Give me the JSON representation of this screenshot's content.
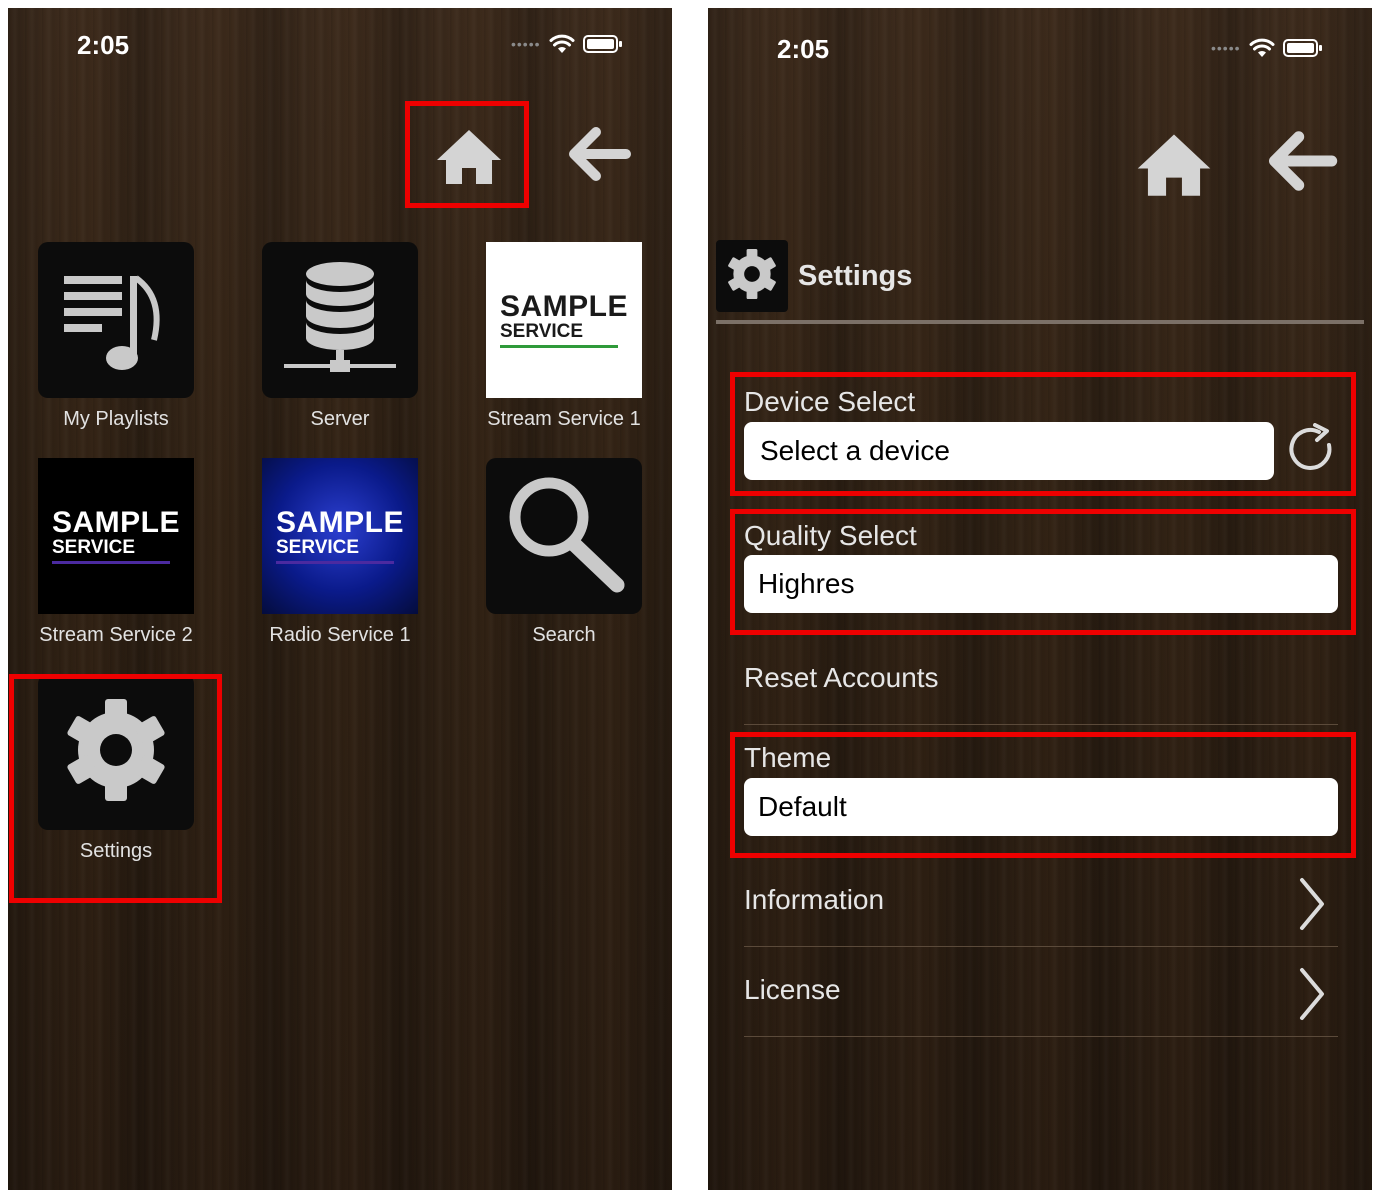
{
  "left": {
    "status": {
      "time": "2:05"
    },
    "grid": [
      {
        "label": "My Playlists",
        "icon": "playlist-music-icon"
      },
      {
        "label": "Server",
        "icon": "database-server-icon"
      },
      {
        "label": "Stream Service 1",
        "logo_main": "SAMPLE",
        "logo_sub": "SERVICE"
      },
      {
        "label": "Stream Service 2",
        "logo_main": "SAMPLE",
        "logo_sub": "SERVICE"
      },
      {
        "label": "Radio Service 1",
        "logo_main": "SAMPLE",
        "logo_sub": "SERVICE"
      },
      {
        "label": "Search",
        "icon": "search-icon"
      },
      {
        "label": "Settings",
        "icon": "gear-icon"
      }
    ]
  },
  "right": {
    "status": {
      "time": "2:05"
    },
    "header": {
      "title": "Settings"
    },
    "device_select": {
      "label": "Device Select",
      "value": "Select a device"
    },
    "quality_select": {
      "label": "Quality Select",
      "value": "Highres"
    },
    "reset": {
      "label": "Reset Accounts"
    },
    "theme": {
      "label": "Theme",
      "value": "Default"
    },
    "information": {
      "label": "Information"
    },
    "license": {
      "label": "License"
    }
  },
  "colors": {
    "highlight": "#ee0000",
    "wood_dark": "#2a1d12",
    "icon_gray": "#c9c9c9",
    "stream1_bar": "#2f9a3a",
    "stream2_bar": "#4b2aa0",
    "radio_bg": "#0a1a8a"
  }
}
